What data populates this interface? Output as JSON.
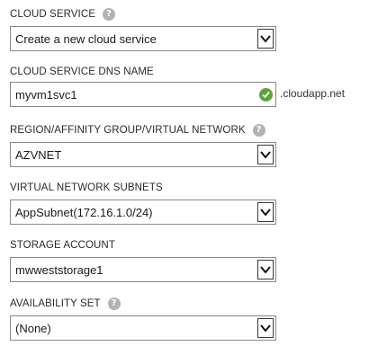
{
  "cloud_service": {
    "label": "CLOUD SERVICE",
    "help": "?",
    "selected": "Create a new cloud service"
  },
  "dns_name": {
    "label": "CLOUD SERVICE DNS NAME",
    "value": "myvm1svc1",
    "suffix": ".cloudapp.net",
    "status": "valid"
  },
  "region": {
    "label": "REGION/AFFINITY GROUP/VIRTUAL NETWORK",
    "help": "?",
    "selected": "AZVNET"
  },
  "subnets": {
    "label": "VIRTUAL NETWORK SUBNETS",
    "selected": "AppSubnet(172.16.1.0/24)"
  },
  "storage": {
    "label": "STORAGE ACCOUNT",
    "selected": "mwweststorage1"
  },
  "availability": {
    "label": "AVAILABILITY SET",
    "help": "?",
    "selected": "(None)"
  },
  "colors": {
    "valid": "#5aa53a",
    "help_icon": "#b3b3b3",
    "border": "#8a8a8a"
  }
}
